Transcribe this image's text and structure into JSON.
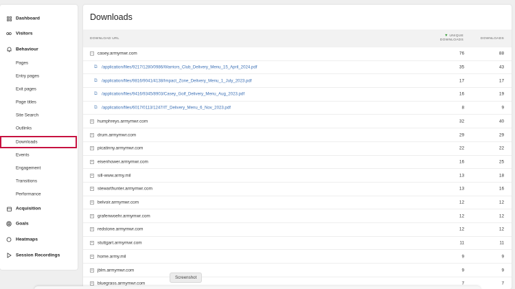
{
  "sidebar": {
    "dashboard": {
      "label": "Dashboard",
      "icon": "grid-icon"
    },
    "visitors": {
      "label": "Visitors",
      "icon": "visitors-icon"
    },
    "behaviour": {
      "label": "Behaviour",
      "icon": "bell-icon"
    },
    "behaviour_items": [
      "Pages",
      "Entry pages",
      "Exit pages",
      "Page titles",
      "Site Search",
      "Outlinks",
      "Downloads",
      "Events",
      "Engagement",
      "Transitions",
      "Performance"
    ],
    "active_item": "Downloads",
    "acquisition": {
      "label": "Acquisition",
      "icon": "folder-icon"
    },
    "goals": {
      "label": "Goals",
      "icon": "target-icon"
    },
    "heatmaps": {
      "label": "Heatmaps",
      "icon": "heatmap-icon"
    },
    "session_recordings": {
      "label": "Session Recordings",
      "icon": "play-icon"
    }
  },
  "main": {
    "title": "Downloads",
    "columns": {
      "url": "DOWNLOAD URL",
      "unique_line1": "UNIQUE",
      "unique_line2": "DOWNLOADS",
      "downloads": "DOWNLOADS"
    },
    "rows": [
      {
        "label": "casey.armymwr.com",
        "unique": "76",
        "downloads": "88",
        "expanded": true
      },
      {
        "label": "/application/files/9217/1280/0986/Warriors_Club_Delivery_Menu_15_April_2024.pdf",
        "unique": "35",
        "downloads": "43",
        "child": true
      },
      {
        "label": "/application/files/9816/9041/4138/Impact_Zone_Delivery_Menu_1_July_2023.pdf",
        "unique": "17",
        "downloads": "17",
        "child": true
      },
      {
        "label": "/application/files/9416/9345/8903/Casey_Golf_Delivery_Menu_Aug_2023.pdf",
        "unique": "16",
        "downloads": "19",
        "child": true
      },
      {
        "label": "/application/files/6017/0113/1247/IT_Delivery_Menu_6_Nov_2023.pdf",
        "unique": "8",
        "downloads": "9",
        "child": true
      },
      {
        "label": "humphreys.armymwr.com",
        "unique": "32",
        "downloads": "40"
      },
      {
        "label": "drum.armymwr.com",
        "unique": "29",
        "downloads": "29"
      },
      {
        "label": "picatinny.armymwr.com",
        "unique": "22",
        "downloads": "22"
      },
      {
        "label": "eisenhower.armymwr.com",
        "unique": "16",
        "downloads": "25"
      },
      {
        "label": "sill-www.army.mil",
        "unique": "13",
        "downloads": "18"
      },
      {
        "label": "stewarthunter.armymwr.com",
        "unique": "13",
        "downloads": "16"
      },
      {
        "label": "belvoir.armymwr.com",
        "unique": "12",
        "downloads": "12"
      },
      {
        "label": "grafenwoehr.armymwr.com",
        "unique": "12",
        "downloads": "12"
      },
      {
        "label": "redstone.armymwr.com",
        "unique": "12",
        "downloads": "12"
      },
      {
        "label": "stuttgart.armymwr.com",
        "unique": "11",
        "downloads": "11"
      },
      {
        "label": "home.army.mil",
        "unique": "9",
        "downloads": "9"
      },
      {
        "label": "jblm.armymwr.com",
        "unique": "9",
        "downloads": "9"
      },
      {
        "label": "bluegrass.armymwr.com",
        "unique": "7",
        "downloads": "7"
      }
    ]
  },
  "tooltip": "Screenshot",
  "colors": {
    "accent_highlight": "#c6103f",
    "link": "#3a6fb5",
    "sort_arrow": "#3a9d3a"
  }
}
